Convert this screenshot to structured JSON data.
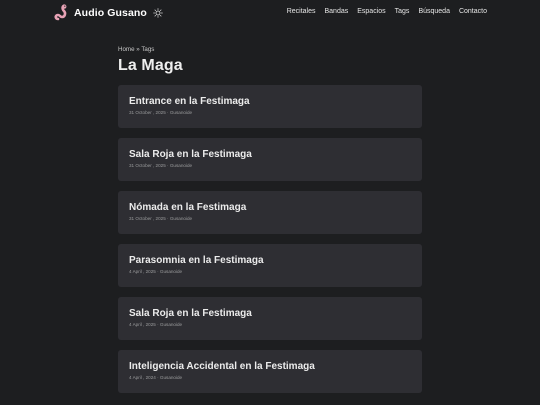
{
  "site": {
    "name": "Audio Gusano",
    "theme_toggle_icon": "sun-icon",
    "logo_icon": "worm-icon",
    "logo_color": "#e7a2b5"
  },
  "menu": {
    "items": [
      "Recitales",
      "Bandas",
      "Espacios",
      "Tags",
      "Búsqueda",
      "Contacto"
    ]
  },
  "breadcrumb": {
    "home": "Home",
    "separator": "»",
    "current": "Tags"
  },
  "page": {
    "title": "La Maga"
  },
  "posts": [
    {
      "title": "Entrance en la Festimaga",
      "meta": "31 October , 2025 · Gusanoide"
    },
    {
      "title": "Sala Roja en la Festimaga",
      "meta": "31 October , 2025 · Gusanoide"
    },
    {
      "title": "Nómada en la Festimaga",
      "meta": "31 October , 2025 · Gusanoide"
    },
    {
      "title": "Parasomnia en la Festimaga",
      "meta": "4 April , 2025 · Gusanoide"
    },
    {
      "title": "Sala Roja en la Festimaga",
      "meta": "4 April , 2025 · Gusanoide"
    },
    {
      "title": "Inteligencia Accidental en la Festimaga",
      "meta": "4 April , 2024 · Gusanoide"
    }
  ],
  "colors": {
    "background": "#1d1e20",
    "card": "#2e2e33",
    "primary_text": "#ececec",
    "secondary_text": "#9b9c9d"
  }
}
